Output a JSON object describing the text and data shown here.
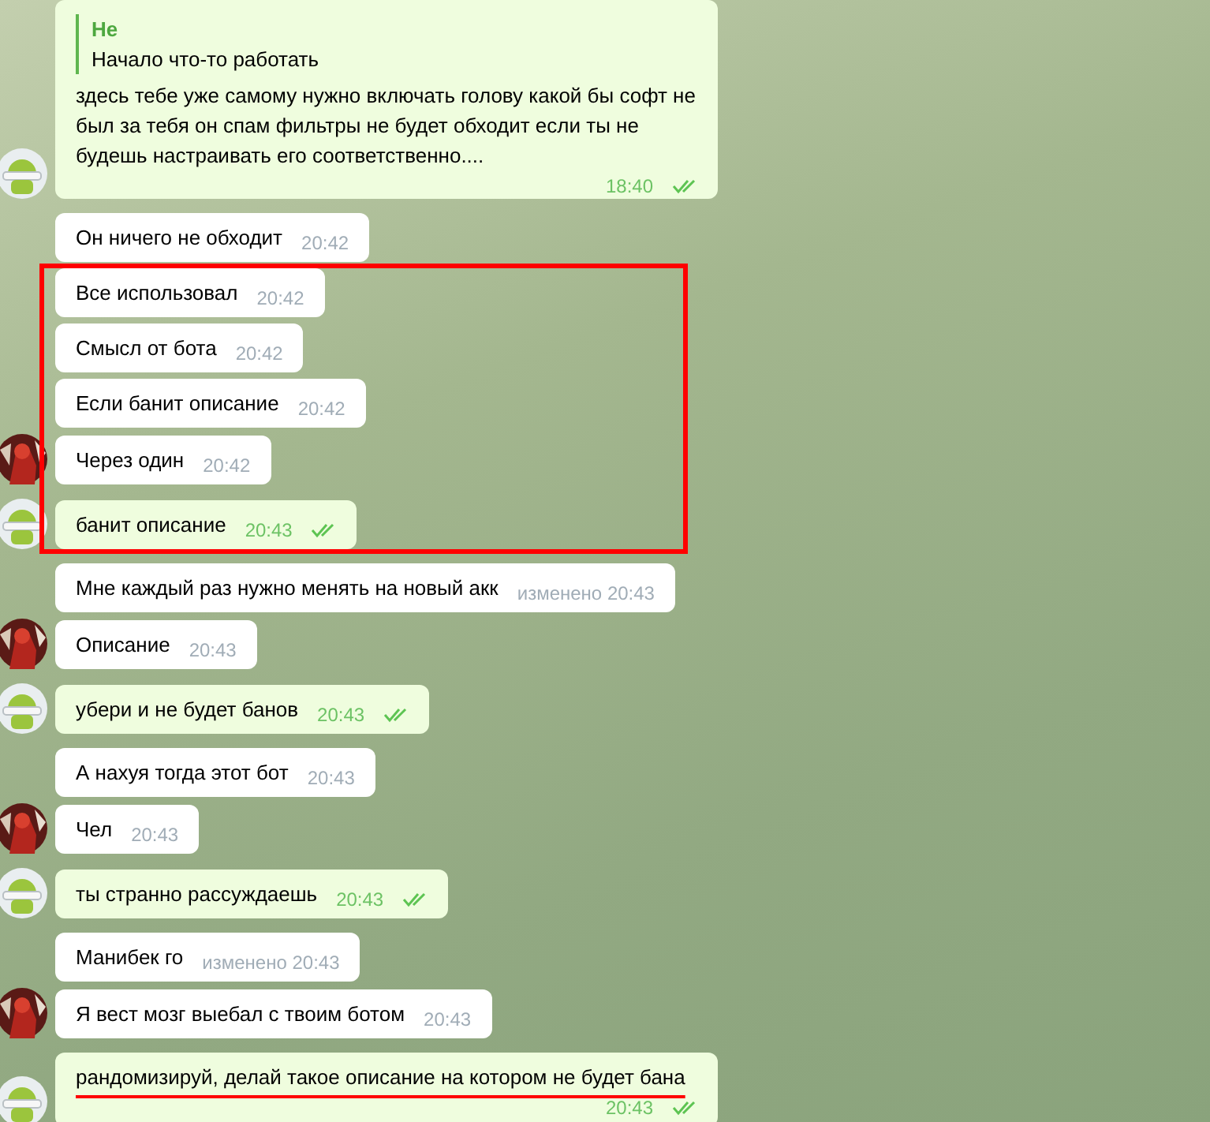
{
  "messages": [
    {
      "kind": "outgoing",
      "reply": {
        "author": "Не",
        "text": "Начало что-то работать"
      },
      "text": "здесь тебе уже самому нужно включать голову какой бы софт не был за тебя он спам фильтры не будет обходит если ты не будешь настраивать его соответственно....",
      "time": "18:40",
      "read": true,
      "avatar": {
        "kind": "robot"
      }
    },
    {
      "kind": "incoming",
      "text": "Он ничего не обходит",
      "time": "20:42"
    },
    {
      "kind": "incoming",
      "text": "Все использовал",
      "time": "20:42",
      "framed": true
    },
    {
      "kind": "incoming",
      "text": "Смысл от бота",
      "time": "20:42",
      "framed": true
    },
    {
      "kind": "incoming",
      "text": "Если банит описание",
      "time": "20:42",
      "framed": true
    },
    {
      "kind": "incoming",
      "text": "Через один",
      "time": "20:42",
      "avatar": {
        "kind": "photo"
      },
      "framed": true
    },
    {
      "kind": "outgoing",
      "text": "банит описание",
      "time": "20:43",
      "read": true,
      "avatar": {
        "kind": "robot"
      },
      "framed": true
    },
    {
      "kind": "incoming",
      "text": "Мне каждый раз нужно менять на новый акк",
      "time": "изменено 20:43"
    },
    {
      "kind": "incoming",
      "text": "Описание",
      "time": "20:43",
      "avatar": {
        "kind": "photo"
      }
    },
    {
      "kind": "outgoing",
      "text": "убери и не будет банов",
      "time": "20:43",
      "read": true,
      "avatar": {
        "kind": "robot"
      }
    },
    {
      "kind": "incoming",
      "text": "А нахуя тогда этот бот",
      "time": "20:43"
    },
    {
      "kind": "incoming",
      "text": "Чел",
      "time": "20:43",
      "avatar": {
        "kind": "photo"
      }
    },
    {
      "kind": "outgoing",
      "text": "ты странно рассуждаешь",
      "time": "20:43",
      "read": true,
      "avatar": {
        "kind": "robot"
      }
    },
    {
      "kind": "incoming",
      "text": "Манибек го",
      "time": "изменено 20:43"
    },
    {
      "kind": "incoming",
      "text": "Я вест мозг выебал с твоим ботом",
      "time": "20:43",
      "avatar": {
        "kind": "photo"
      }
    },
    {
      "kind": "outgoing",
      "text": "рандомизируй, делай такое описание на котором не будет бана",
      "time": "20:43",
      "read": true,
      "avatar": {
        "kind": "robot"
      },
      "underlined": true
    }
  ]
}
